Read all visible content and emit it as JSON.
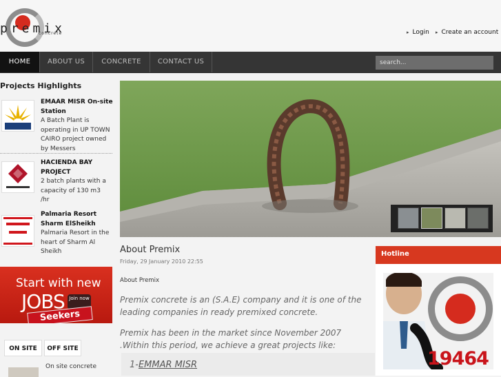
{
  "brand": {
    "name": "premix",
    "tagline": "concrete"
  },
  "header": {
    "login": "Login",
    "create_account": "Create an account"
  },
  "nav": {
    "home": "HOME",
    "about": "ABOUT US",
    "concrete": "CONCRETE",
    "contact": "CONTACT US",
    "search_placeholder": "search..."
  },
  "sidebar": {
    "title": "Projects Highlights",
    "projects": [
      {
        "title": "EMAAR MISR On-site Station",
        "desc": "A Batch Plant is operating in UP TOWN CAIRO project owned by Messers",
        "logo": "EMAAR"
      },
      {
        "title": "HACIENDA BAY PROJECT",
        "desc": "2 batch plants with a capacity of 130 m3 /hr",
        "logo": "PALM HILLS"
      },
      {
        "title": "Palmaria Resort Sharm ElSheikh",
        "desc": "Palmaria Resort in the heart of Sharm Al Sheikh",
        "logo": "PALMARIA RESORT"
      }
    ],
    "jobs": {
      "line1": "Start with new",
      "line2": "JOBS",
      "button": "Join now",
      "seekers": "Seekers"
    },
    "tabs": {
      "on_site": "ON SITE",
      "off_site": "OFF SITE"
    },
    "onsite_text": "On site concrete"
  },
  "about": {
    "title": "About Premix",
    "date": "Friday, 29 January 2010 22:55",
    "subtitle": "About Premix",
    "p1": "Premix concrete is an (S.A.E) company and it is one of the leading companies in ready premixed concrete.",
    "p2": "Premix has been in the market since November 2007 .Within this period, we achieve a great projects like:",
    "item_prefix": "1-",
    "item_link": "EMMAR MISR"
  },
  "hotline": {
    "title": "Hotline",
    "number": "19464"
  },
  "colors": {
    "accent": "#d7381f",
    "nav_bg": "#353535"
  }
}
